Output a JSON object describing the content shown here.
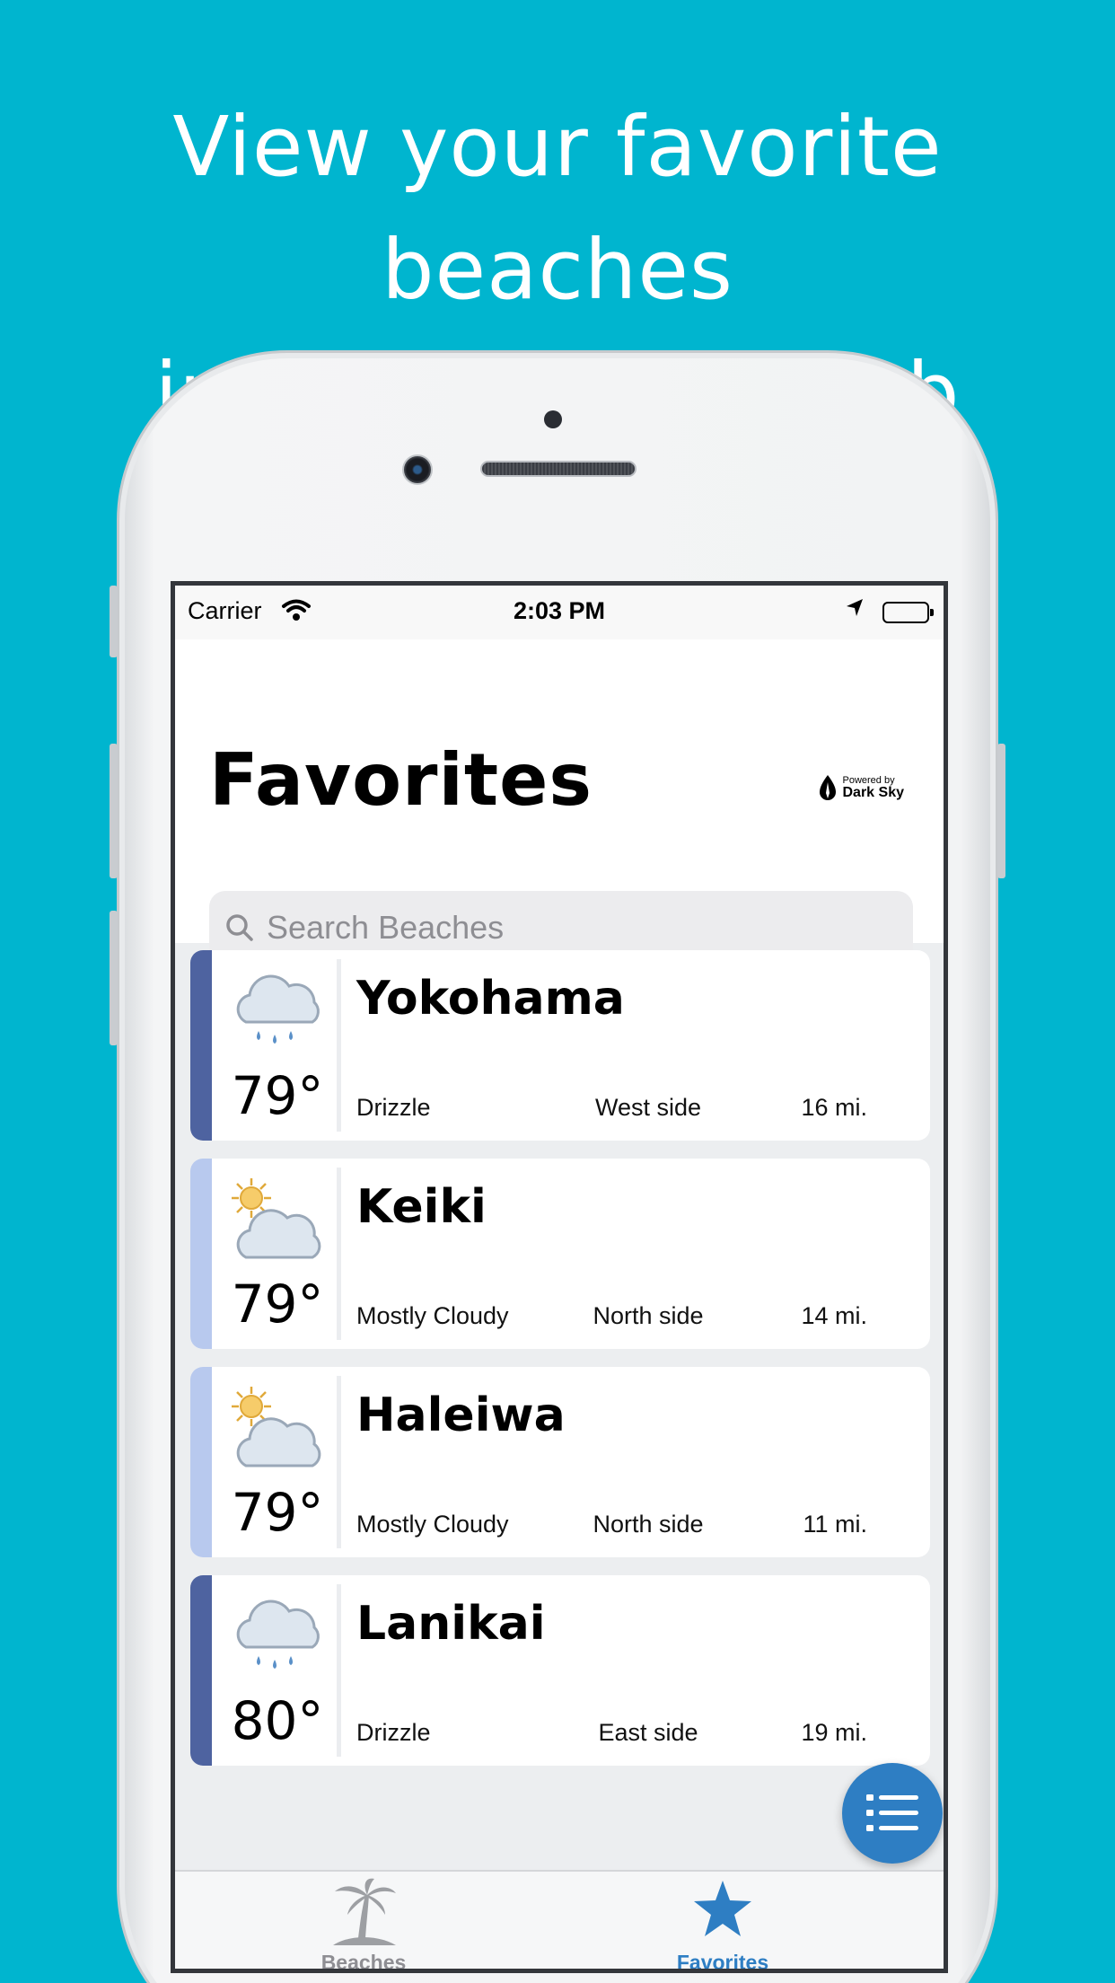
{
  "headline": {
    "line1": "View your favorite beaches",
    "line2": "in the favorites tab"
  },
  "status_bar": {
    "carrier": "Carrier",
    "time": "2:03 PM"
  },
  "page": {
    "title": "Favorites",
    "powered_small": "Powered by",
    "powered_big": "Dark Sky"
  },
  "search": {
    "placeholder": "Search Beaches"
  },
  "beaches": [
    {
      "name": "Yokohama",
      "temp": "79°",
      "condition": "Drizzle",
      "side": "West side",
      "distance": "16 mi.",
      "icon": "rain-cloud-icon",
      "band_color": "#4e63a0"
    },
    {
      "name": "Keiki",
      "temp": "79°",
      "condition": "Mostly Cloudy",
      "side": "North side",
      "distance": "14 mi.",
      "icon": "partly-cloudy-icon",
      "band_color": "#b8c9ee"
    },
    {
      "name": "Haleiwa",
      "temp": "79°",
      "condition": "Mostly Cloudy",
      "side": "North side",
      "distance": "11 mi.",
      "icon": "partly-cloudy-icon",
      "band_color": "#b8c9ee"
    },
    {
      "name": "Lanikai",
      "temp": "80°",
      "condition": "Drizzle",
      "side": "East side",
      "distance": "19 mi.",
      "icon": "rain-cloud-icon",
      "band_color": "#4e63a0"
    }
  ],
  "tabs": {
    "beaches": "Beaches",
    "favorites": "Favorites"
  },
  "colors": {
    "background": "#00b5cf",
    "accent": "#2e7ec3",
    "inactive_tab": "#8e8e93"
  }
}
